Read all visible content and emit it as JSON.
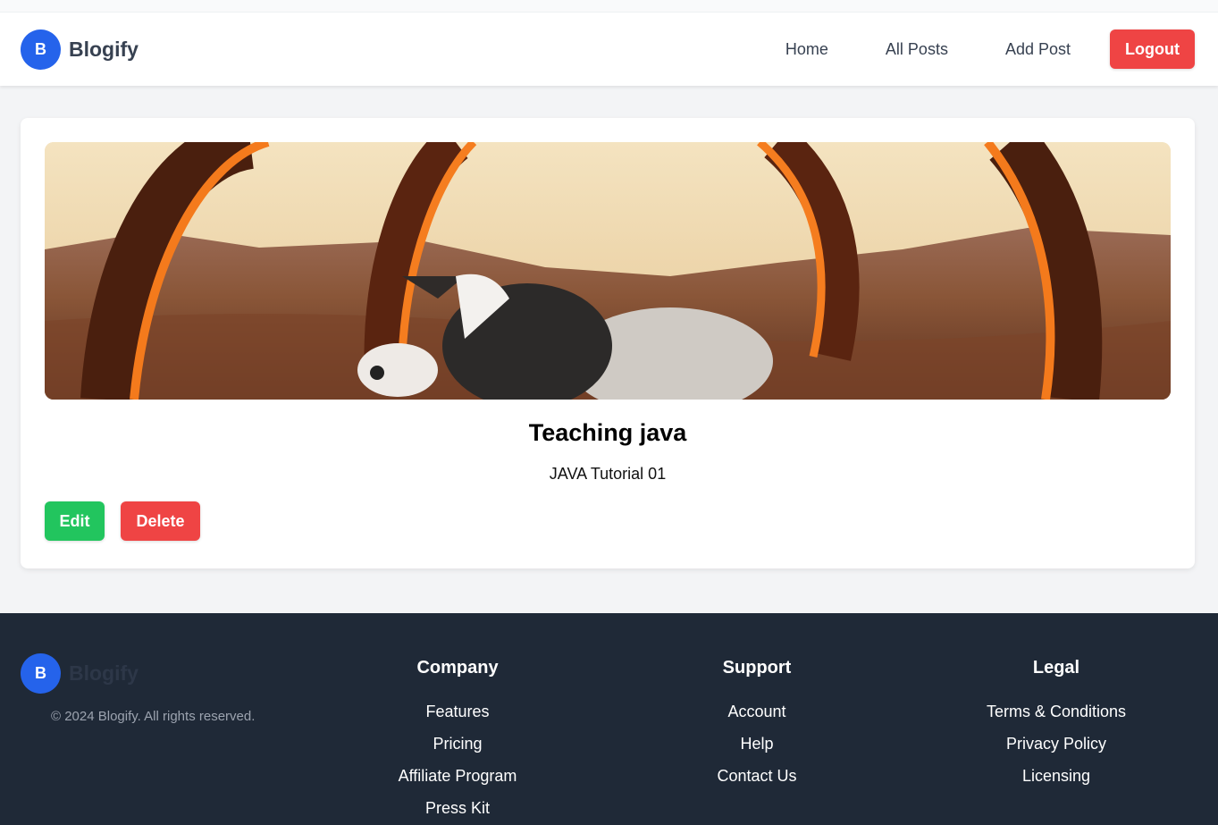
{
  "header": {
    "logo_letter": "B",
    "brand": "Blogify",
    "nav": [
      "Home",
      "All Posts",
      "Add Post"
    ],
    "logout_label": "Logout"
  },
  "post": {
    "title": "Teaching java",
    "subtitle": "JAVA Tutorial 01",
    "edit_label": "Edit",
    "delete_label": "Delete"
  },
  "footer": {
    "logo_letter": "B",
    "brand": "Blogify",
    "copyright": "© 2024 Blogify. All rights reserved.",
    "columns": [
      {
        "title": "Company",
        "links": [
          "Features",
          "Pricing",
          "Affiliate Program",
          "Press Kit"
        ]
      },
      {
        "title": "Support",
        "links": [
          "Account",
          "Help",
          "Contact Us"
        ]
      },
      {
        "title": "Legal",
        "links": [
          "Terms & Conditions",
          "Privacy Policy",
          "Licensing"
        ]
      }
    ]
  },
  "colors": {
    "primary": "#2563eb",
    "danger": "#ef4444",
    "success": "#22c55e",
    "footer_bg": "#1f2937",
    "page_bg": "#f3f4f6"
  }
}
